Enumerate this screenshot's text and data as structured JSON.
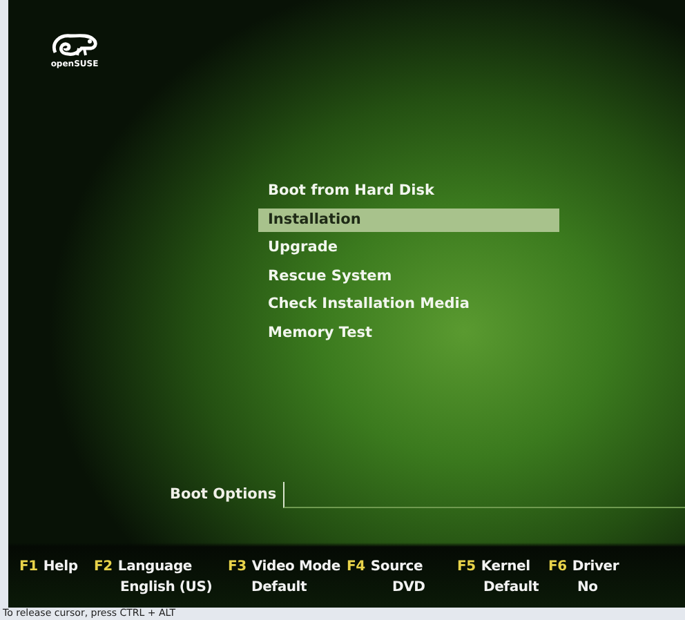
{
  "logo": {
    "text": "openSUSE"
  },
  "menu": [
    {
      "label": "Boot from Hard Disk",
      "selected": false
    },
    {
      "label": "Installation",
      "selected": true
    },
    {
      "label": "Upgrade",
      "selected": false
    },
    {
      "label": "Rescue System",
      "selected": false
    },
    {
      "label": "Check Installation Media",
      "selected": false
    },
    {
      "label": "Memory Test",
      "selected": false
    }
  ],
  "boot_options": {
    "label": "Boot Options"
  },
  "function_keys": [
    {
      "key": "F1",
      "name": "Help"
    },
    {
      "key": "F2",
      "name": "Language",
      "value": "English (US)"
    },
    {
      "key": "F3",
      "name": "Video Mode",
      "value": "Default"
    },
    {
      "key": "F4",
      "name": "Source",
      "value": "DVD"
    },
    {
      "key": "F5",
      "name": "Kernel",
      "value": "Default"
    },
    {
      "key": "F6",
      "name": "Driver",
      "value": "No"
    }
  ],
  "status_bar": "To release cursor, press CTRL + ALT"
}
